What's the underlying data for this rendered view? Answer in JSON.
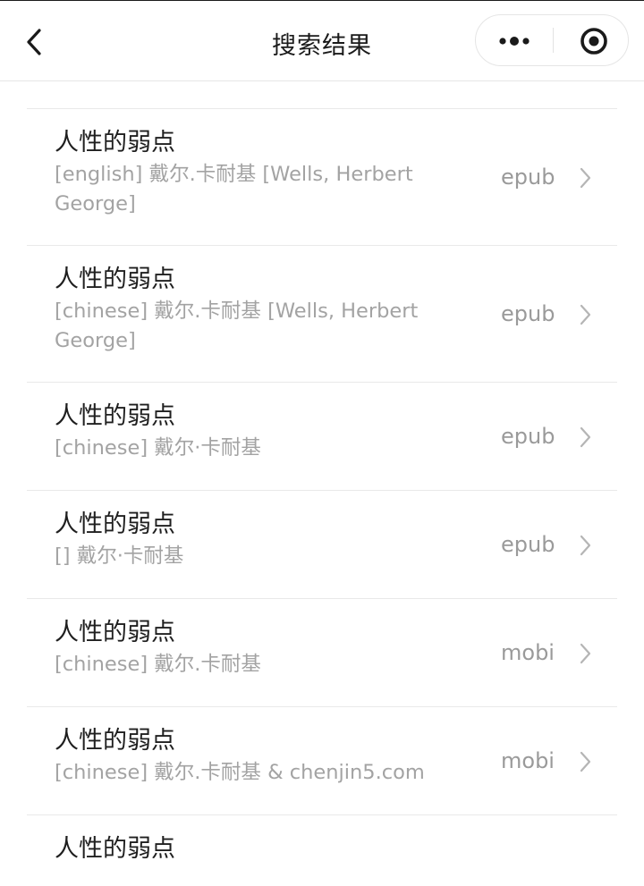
{
  "navbar": {
    "title": "搜索结果",
    "back_icon": "chevron-left-icon",
    "more_icon": "more-dots-icon",
    "close_icon": "target-close-icon"
  },
  "results": [
    {
      "title": "人性的弱点",
      "subtitle": "[english] 戴尔.卡耐基 [Wells, Herbert George]",
      "format": "epub"
    },
    {
      "title": "人性的弱点",
      "subtitle": "[chinese] 戴尔.卡耐基 [Wells, Herbert George]",
      "format": "epub"
    },
    {
      "title": "人性的弱点",
      "subtitle": "[chinese] 戴尔·卡耐基",
      "format": "epub"
    },
    {
      "title": "人性的弱点",
      "subtitle": "[] 戴尔·卡耐基",
      "format": "epub"
    },
    {
      "title": "人性的弱点",
      "subtitle": "[chinese] 戴尔.卡耐基",
      "format": "mobi"
    },
    {
      "title": "人性的弱点",
      "subtitle": "[chinese] 戴尔.卡耐基 & chenjin5.com",
      "format": "mobi"
    },
    {
      "title": "人性的弱点",
      "subtitle": "",
      "format": ""
    }
  ],
  "colors": {
    "title_text": "#1f1f1f",
    "subtitle_text": "#a3a3a3",
    "format_text": "#9a9a9a",
    "divider": "#e9e9e9"
  }
}
